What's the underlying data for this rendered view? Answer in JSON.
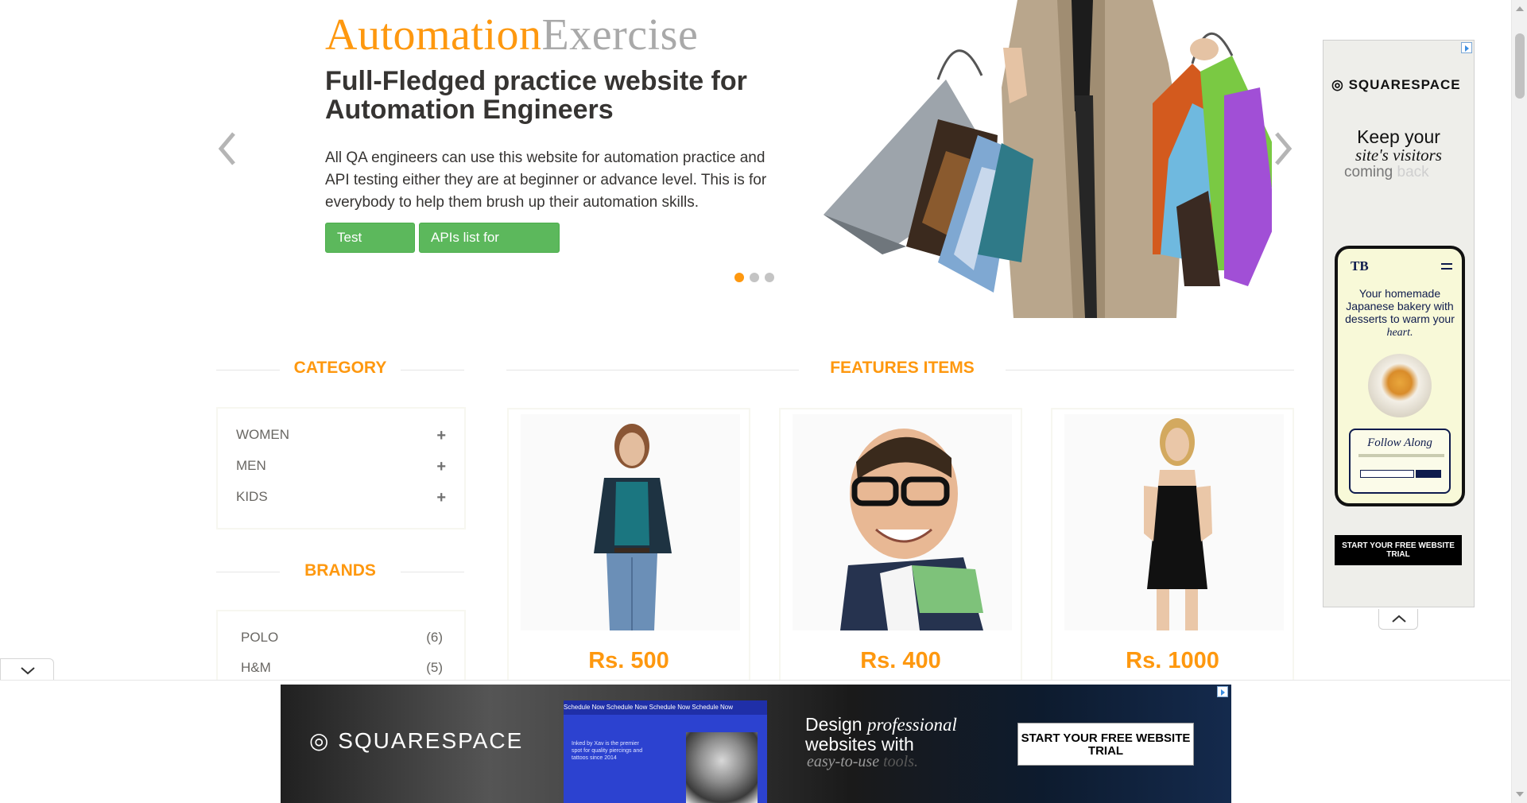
{
  "slider": {
    "brand_part1": "Automation",
    "brand_part2": "Exercise",
    "headline": "Full-Fledged practice website for Automation Engineers",
    "description": "All QA engineers can use this website for automation practice and API testing either they are at beginner or advance level. This is for everybody to help them brush up their automation skills.",
    "btn_test_cases": "Test Cases",
    "btn_apis": "APIs list for practice",
    "indicator_count": 3,
    "active_indicator": 0
  },
  "category": {
    "title": "CATEGORY",
    "items": [
      {
        "label": "WOMEN",
        "toggle": "+"
      },
      {
        "label": "MEN",
        "toggle": "+"
      },
      {
        "label": "KIDS",
        "toggle": "+"
      }
    ]
  },
  "brands": {
    "title": "BRANDS",
    "items": [
      {
        "label": "POLO",
        "count": "(6)"
      },
      {
        "label": "H&M",
        "count": "(5)"
      }
    ]
  },
  "features": {
    "title": "FEATURES ITEMS",
    "products": [
      {
        "price": "Rs. 500",
        "image": "woman-casual-outfit"
      },
      {
        "price": "Rs. 400",
        "image": "man-glasses-polo"
      },
      {
        "price": "Rs. 1000",
        "image": "woman-black-dress"
      }
    ]
  },
  "side_ad": {
    "brand": "SQUARESPACE",
    "line1": "Keep your",
    "line2": "site's visitors",
    "line3a": "coming",
    "line3b": "back",
    "phone_logo": "TB",
    "phone_tagline_a": "Your homemade Japanese bakery with desserts to warm your",
    "phone_tagline_b": "heart.",
    "follow": "Follow Along",
    "cta": "START YOUR FREE WEBSITE TRIAL"
  },
  "bottom_ad": {
    "brand": "SQUARESPACE",
    "shot_nav": "Schedule Now   Schedule Now   Schedule Now   Schedule Now",
    "shot_text": "Inked by Xav is the premier spot for quality piercings and tattoos since 2014",
    "design_a": "Design",
    "design_b": "professional",
    "design_c": "websites with",
    "easy_a": "easy-to-use",
    "easy_b": "tools.",
    "cta": "START YOUR FREE WEBSITE TRIAL"
  },
  "colors": {
    "accent": "#fe980f",
    "button": "#5cb85c",
    "text_dark": "#363432",
    "text": "#696763"
  }
}
